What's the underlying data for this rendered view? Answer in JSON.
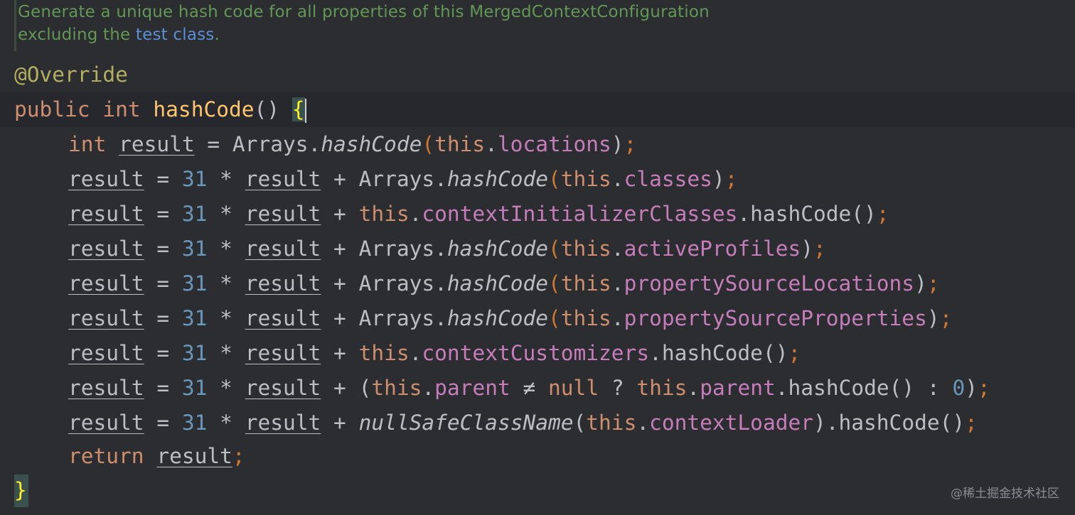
{
  "doc_comment": {
    "line1": "Generate a unique hash code for all properties of this MergedContextConfiguration",
    "line2_prefix": "excluding the ",
    "line2_link": "test class",
    "line2_suffix": "."
  },
  "code": {
    "annotation": "@Override",
    "signature": {
      "kw_public": "public",
      "kw_int": "int",
      "method": "hashCode",
      "parens": "()",
      "brace": "{"
    },
    "line_decl": {
      "kw_int": "int",
      "var": "result",
      "eq": " = Arrays.",
      "call": "hashCode",
      "open": "(",
      "this": "this",
      "dot": ".",
      "field": "locations",
      "close": ")",
      "semi": ";"
    },
    "lines": [
      {
        "kind": "arrays",
        "field": "classes"
      },
      {
        "kind": "this-hash",
        "field": "contextInitializerClasses"
      },
      {
        "kind": "arrays",
        "field": "activeProfiles"
      },
      {
        "kind": "arrays",
        "field": "propertySourceLocations"
      },
      {
        "kind": "arrays",
        "field": "propertySourceProperties"
      },
      {
        "kind": "this-hash",
        "field": "contextCustomizers"
      },
      {
        "kind": "ternary",
        "field": "parent"
      },
      {
        "kind": "nullsafe",
        "field": "contextLoader"
      }
    ],
    "tokens": {
      "result": "result",
      "eq": " = ",
      "num31": "31",
      "times": " * ",
      "plus": " + ",
      "arrays": "Arrays.",
      "hashCode_call": "hashCode",
      "this": "this",
      "dot": ".",
      "hashCode_plain": "hashCode()",
      "open": "(",
      "close": ")",
      "semi": ";",
      "neq": " ≠ ",
      "null": "null",
      "question": " ? ",
      "colon": " : ",
      "zero": "0",
      "nullsafe": "nullSafeClassName"
    },
    "return_kw": "return",
    "return_var": "result",
    "closing_brace": "}"
  },
  "watermark": "@稀土掘金技术社区",
  "colors": {
    "background": "#2b2d30",
    "comment": "#629755",
    "keyword": "#cf8e6d",
    "annotation": "#b3ae60",
    "number": "#6897bb",
    "field": "#c77dbb",
    "method_decl": "#ffc66d"
  }
}
